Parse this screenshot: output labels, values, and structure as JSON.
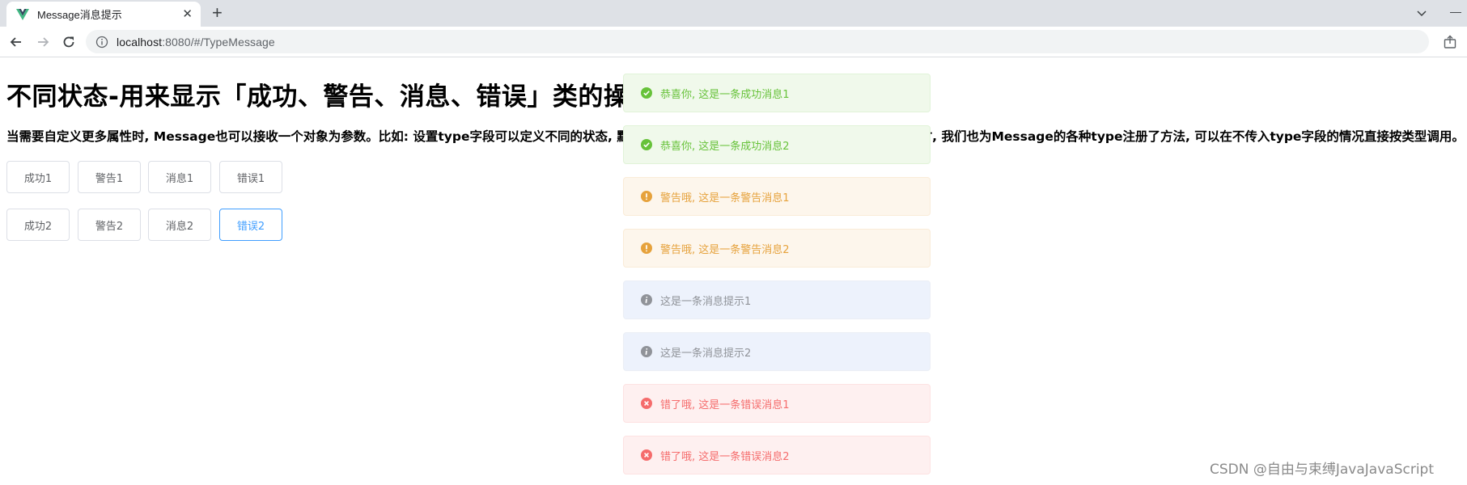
{
  "browser": {
    "tab_title": "Message消息提示",
    "url_host": "localhost",
    "url_rest": ":8080/#/TypeMessage",
    "icons": {
      "favicon": "vue-logo-icon",
      "close": "close-icon",
      "new_tab": "plus-icon",
      "back": "back-arrow-icon",
      "forward": "forward-arrow-icon",
      "reload": "reload-icon",
      "info": "info-icon",
      "share": "share-icon",
      "tab_search": "chevron-down-icon",
      "minimize": "minimize-icon"
    }
  },
  "page": {
    "title": "不同状态-用来显示「成功、警告、消息、错误」类的操作反馈。",
    "description": "当需要自定义更多属性时, Message也可以接收一个对象为参数。比如: 设置type字段可以定义不同的状态, 默认为info。此时正文内容以message的值传入。同时, 我们也为Message的各种type注册了方法, 可以在不传入type字段的情况直接按类型调用。"
  },
  "buttons_row1": [
    "成功1",
    "警告1",
    "消息1",
    "错误1"
  ],
  "buttons_row2": [
    "成功2",
    "警告2",
    "消息2",
    "错误2"
  ],
  "messages": [
    {
      "type": "success",
      "text": "恭喜你, 这是一条成功消息1"
    },
    {
      "type": "success",
      "text": "恭喜你, 这是一条成功消息2"
    },
    {
      "type": "warning",
      "text": "警告哦, 这是一条警告消息1"
    },
    {
      "type": "warning",
      "text": "警告哦, 这是一条警告消息2"
    },
    {
      "type": "info",
      "text": "这是一条消息提示1"
    },
    {
      "type": "info",
      "text": "这是一条消息提示2"
    },
    {
      "type": "error",
      "text": "错了哦, 这是一条错误消息1"
    },
    {
      "type": "error",
      "text": "错了哦, 这是一条错误消息2"
    }
  ],
  "colors": {
    "success": "#67c23a",
    "warning": "#e6a23c",
    "info": "#909399",
    "error": "#f56c6c",
    "primary": "#409eff"
  },
  "watermark": "CSDN @自由与束缚JavaJavaScript"
}
